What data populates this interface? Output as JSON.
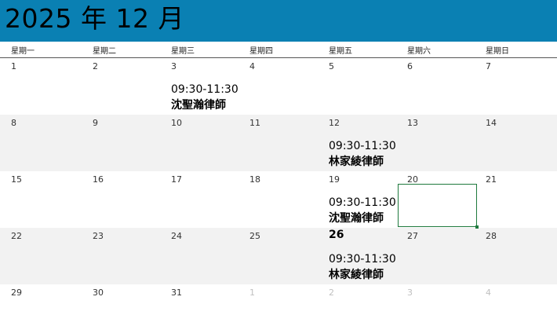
{
  "header": {
    "title": "2025 年 12 月"
  },
  "weekdays": [
    "星期一",
    "星期二",
    "星期三",
    "星期四",
    "星期五",
    "星期六",
    "星期日"
  ],
  "weeks": [
    {
      "days": [
        "1",
        "2",
        "3",
        "4",
        "5",
        "6",
        "7"
      ]
    },
    {
      "days": [
        "8",
        "9",
        "10",
        "11",
        "12",
        "13",
        "14"
      ]
    },
    {
      "days": [
        "15",
        "16",
        "17",
        "18",
        "19",
        "20",
        "21"
      ]
    },
    {
      "days": [
        "22",
        "23",
        "24",
        "25",
        "26",
        "27",
        "28"
      ]
    },
    {
      "days": [
        "29",
        "30",
        "31",
        "1",
        "2",
        "3",
        "4"
      ]
    }
  ],
  "events": [
    {
      "time": "09:30-11:30",
      "name": "沈聖瀚律師"
    },
    {
      "time": "09:30-11:30",
      "name": "林家綾律師"
    },
    {
      "time": "09:30-11:30",
      "name": "沈聖瀚律師"
    },
    {
      "time": "09:30-11:30",
      "name": "林家綾律師"
    }
  ]
}
